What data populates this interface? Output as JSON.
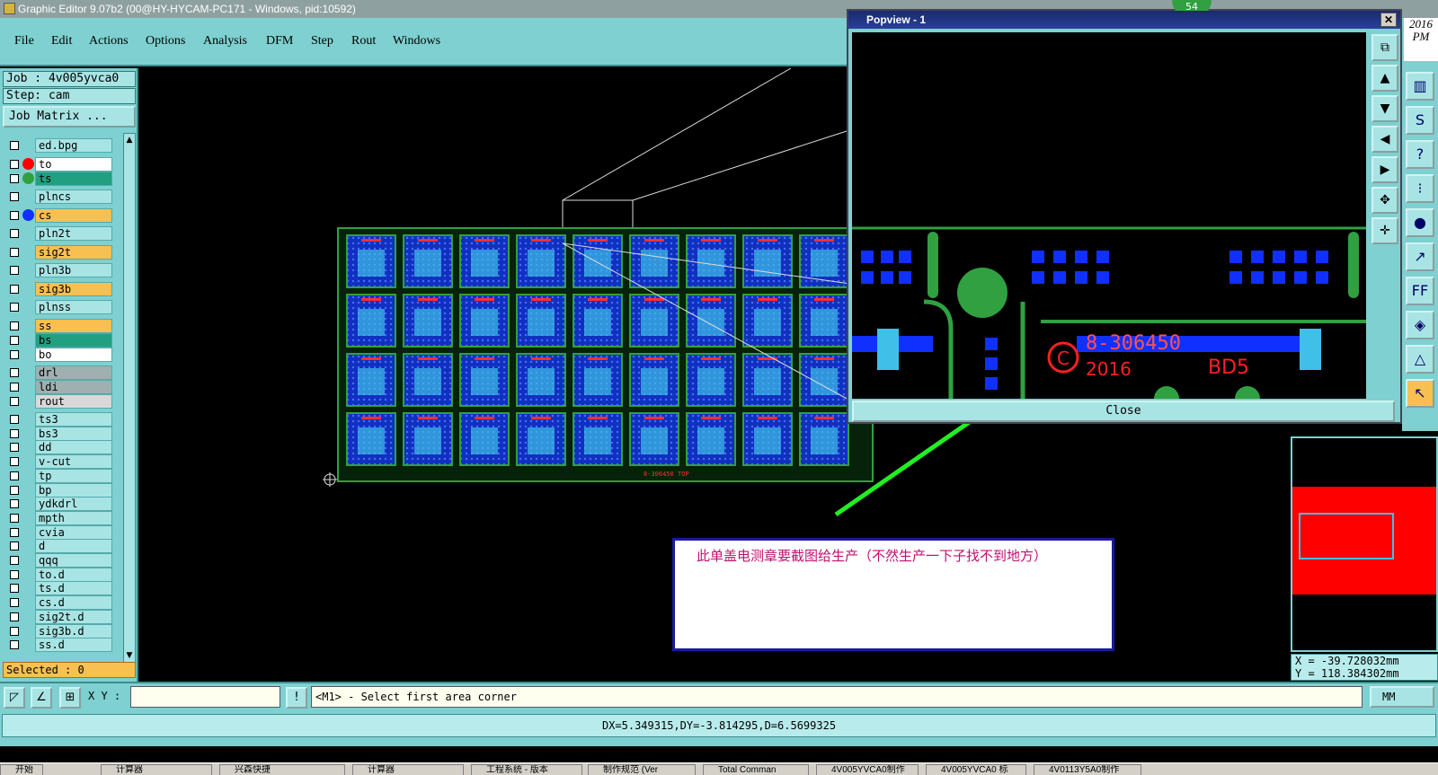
{
  "window": {
    "title": "Graphic Editor 9.07b2 (00@HY-HYCAM-PC171 - Windows, pid:10592)"
  },
  "menu": [
    "File",
    "Edit",
    "Actions",
    "Options",
    "Analysis",
    "DFM",
    "Step",
    "Rout",
    "Windows"
  ],
  "job": {
    "label": "Job : 4v005yvca0",
    "step": "Step: cam",
    "matrix_button": "Job Matrix ..."
  },
  "layers": [
    {
      "name": "ed.bpg"
    },
    {
      "name": "to"
    },
    {
      "name": "ts"
    },
    {
      "name": "plncs"
    },
    {
      "name": "cs"
    },
    {
      "name": "pln2t"
    },
    {
      "name": "sig2t"
    },
    {
      "name": "pln3b"
    },
    {
      "name": "sig3b"
    },
    {
      "name": "plnss"
    },
    {
      "name": "ss"
    },
    {
      "name": "bs"
    },
    {
      "name": "bo"
    },
    {
      "name": "drl"
    },
    {
      "name": "ldi"
    },
    {
      "name": "rout"
    },
    {
      "name": "ts3"
    },
    {
      "name": "bs3"
    },
    {
      "name": "dd"
    },
    {
      "name": "v-cut"
    },
    {
      "name": "tp"
    },
    {
      "name": "bp"
    },
    {
      "name": "ydkdrl"
    },
    {
      "name": "mpth"
    },
    {
      "name": "cvia"
    },
    {
      "name": "d"
    },
    {
      "name": "qqq"
    },
    {
      "name": "to.d"
    },
    {
      "name": "ts.d"
    },
    {
      "name": "cs.d"
    },
    {
      "name": "sig2t.d"
    },
    {
      "name": "sig3b.d"
    },
    {
      "name": "ss.d"
    }
  ],
  "selected": "Selected : 0",
  "bottom": {
    "xy_label": "X Y :",
    "xy_value": "",
    "prompt": "<M1> - Select first area corner",
    "units": "MM"
  },
  "status": "DX=5.349315,DY=-3.814295,D=6.5699325",
  "coords": {
    "x": "X = -39.728032mm",
    "y": "Y = 118.384302mm"
  },
  "date": {
    "year": "2016",
    "ampm": "PM"
  },
  "popview": {
    "title": "Popview - 1",
    "close_label": "Close",
    "badge": "54",
    "board_text": "8-306450",
    "year_text": "2016",
    "code_text": "BD5"
  },
  "board_label": "8-306450 TOP",
  "note": "此单盖电测章要截图给生产（不然生产一下子找不到地方）",
  "taskbar": [
    "开始",
    "计算器",
    "兴森快捷",
    "计算器",
    "工程系统 - 版本",
    "制作规范 (Ver",
    "Total Comman",
    "4V005YVCA0制作",
    "4V005YVCA0 标",
    "4V0113Y5A0制作"
  ],
  "colors": {
    "panel": "#7fd0d0",
    "accent": "#f8c050",
    "board": "#1030c0",
    "trace": "#30a040"
  }
}
